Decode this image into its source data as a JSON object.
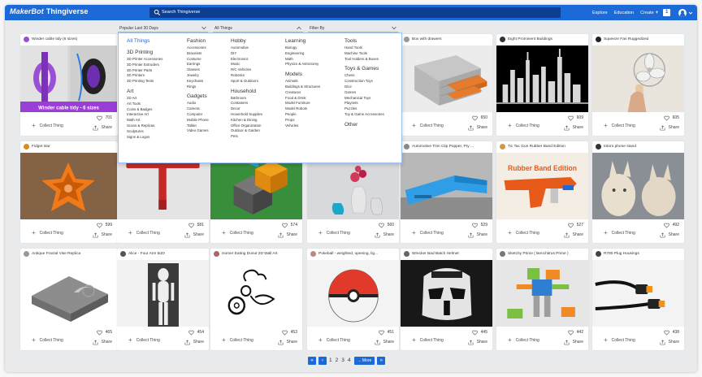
{
  "header": {
    "logo_brand": "MakerBot",
    "logo_product": "Thingiverse",
    "search_placeholder": "Search Thingiverse",
    "nav": [
      "Explore",
      "Education"
    ],
    "create_label": "Create",
    "notification_count": "1",
    "brand_color": "#1b6ad8"
  },
  "filters": {
    "time": "Popular Last 30 Days",
    "category": "All Things",
    "filter_by": "Filter By"
  },
  "dropdown": {
    "columns": [
      {
        "groups": [
          {
            "title": "All Things",
            "items": []
          },
          {
            "title": "3D Printing",
            "items": [
              "3D Printer Accessories",
              "3D Printer Extruders",
              "3D Printer Parts",
              "3D Printers",
              "3D Printing Tests"
            ]
          },
          {
            "title": "Art",
            "items": [
              "2D Art",
              "Art Tools",
              "Coins & Badges",
              "Interactive Art",
              "Math Art",
              "Scans & Replicas",
              "Sculptures",
              "Signs & Logos"
            ]
          }
        ]
      },
      {
        "groups": [
          {
            "title": "Fashion",
            "items": [
              "Accessories",
              "Bracelets",
              "Costume",
              "Earrings",
              "Glasses",
              "Jewelry",
              "Keychains",
              "Rings"
            ]
          },
          {
            "title": "Gadgets",
            "items": [
              "Audio",
              "Camera",
              "Computer",
              "Mobile Phone",
              "Tablet",
              "Video Games"
            ]
          }
        ]
      },
      {
        "groups": [
          {
            "title": "Hobby",
            "items": [
              "Automotive",
              "DIY",
              "Electronics",
              "Music",
              "R/C Vehicles",
              "Robotics",
              "Sport & Outdoors"
            ]
          },
          {
            "title": "Household",
            "items": [
              "Bathroom",
              "Containers",
              "Decor",
              "Household Supplies",
              "Kitchen & Dining",
              "Office Organization",
              "Outdoor & Garden",
              "Pets"
            ]
          }
        ]
      },
      {
        "groups": [
          {
            "title": "Learning",
            "items": [
              "Biology",
              "Engineering",
              "Math",
              "Physics & Astronomy"
            ]
          },
          {
            "title": "Models",
            "items": [
              "Animals",
              "Buildings & Structures",
              "Creatures",
              "Food & Drink",
              "Model Furniture",
              "Model Robots",
              "People",
              "Props",
              "Vehicles"
            ]
          }
        ]
      },
      {
        "groups": [
          {
            "title": "Tools",
            "items": [
              "Hand Tools",
              "Machine Tools",
              "Tool Holders & Boxes"
            ]
          },
          {
            "title": "Toys & Games",
            "items": [
              "Chess",
              "Construction Toys",
              "Dice",
              "Games",
              "Mechanical Toys",
              "Playsets",
              "Puzzles",
              "Toy & Game Accessories"
            ]
          },
          {
            "title": "Other",
            "items": []
          }
        ]
      }
    ]
  },
  "cards": [
    {
      "title": "Winder cable tidy (6 sizes)",
      "likes": "701",
      "img_caption": "Winder cable tidy - 6 sizes",
      "img": "winder"
    },
    {
      "title": "",
      "likes": "",
      "img": "hidden"
    },
    {
      "title": "",
      "likes": "",
      "img": "hidden"
    },
    {
      "title": "",
      "likes": "",
      "img": "hidden"
    },
    {
      "title": "Box with drawers",
      "likes": "650",
      "img": "drawers"
    },
    {
      "title": "Eight Prominent Buildings",
      "likes": "609",
      "img": "buildings"
    },
    {
      "title": "Squeeze Fan Ruggedized",
      "likes": "605",
      "img": "fan"
    },
    {
      "title": "Fidget star",
      "likes": "599",
      "img": "star"
    },
    {
      "title": "",
      "likes": "581",
      "img": "wrench"
    },
    {
      "title": "",
      "likes": "574",
      "img": "cube"
    },
    {
      "title": "",
      "likes": "560",
      "img": "vases"
    },
    {
      "title": "Automotive Trim Clip Popper, Pry ...",
      "likes": "529",
      "img": "popper"
    },
    {
      "title": "Tic Tac Gun Rubber Band Edition",
      "likes": "527",
      "img": "gun",
      "img_caption": "Rubber Band Edition"
    },
    {
      "title": "totoro phone stand",
      "likes": "492",
      "img": "totoro"
    },
    {
      "title": "Antique Fractal Vise Replica",
      "likes": "465",
      "img": "vise"
    },
    {
      "title": "Alice - Four Arm BJD",
      "likes": "454",
      "img": "doll"
    },
    {
      "title": "Homer Eating Donut 2D Wall Art",
      "likes": "453",
      "img": "homer"
    },
    {
      "title": "Pokeball - weighted, opening, lig...",
      "likes": "451",
      "img": "pokeball"
    },
    {
      "title": "Wrecker Bad Batch Helmet",
      "likes": "445",
      "img": "helmet"
    },
    {
      "title": "Sketchy Prime ( Benchitrus Prime )",
      "likes": "442",
      "img": "robot"
    },
    {
      "title": "R780 Plug Housings",
      "likes": "438",
      "img": "plug"
    }
  ],
  "card_actions": {
    "collect": "Collect Thing",
    "share": "Share"
  },
  "pagination": {
    "first": "«",
    "prev": "‹",
    "pages": [
      "1",
      "2",
      "3",
      "4"
    ],
    "more": "More",
    "last": "»"
  }
}
